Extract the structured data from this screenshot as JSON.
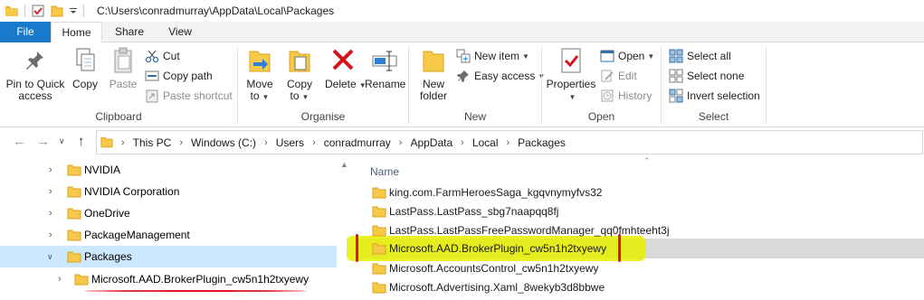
{
  "window": {
    "title": "C:\\Users\\conradmurray\\AppData\\Local\\Packages"
  },
  "ribbon_tabs": [
    {
      "label": "File"
    },
    {
      "label": "Home",
      "active": true
    },
    {
      "label": "Share"
    },
    {
      "label": "View"
    }
  ],
  "ribbon": {
    "clipboard": {
      "label": "Clipboard",
      "pin": "Pin to Quick access",
      "copy": "Copy",
      "paste": "Paste",
      "cut": "Cut",
      "copy_path": "Copy path",
      "paste_shortcut": "Paste shortcut"
    },
    "organise": {
      "label": "Organise",
      "move_to": "Move to",
      "copy_to": "Copy to",
      "delete": "Delete",
      "rename": "Rename"
    },
    "new": {
      "label": "New",
      "new_folder": "New folder",
      "new_item": "New item",
      "easy_access": "Easy access"
    },
    "open": {
      "label": "Open",
      "properties": "Properties",
      "open": "Open",
      "edit": "Edit",
      "history": "History"
    },
    "select": {
      "label": "Select",
      "select_all": "Select all",
      "select_none": "Select none",
      "invert_selection": "Invert selection"
    }
  },
  "address": {
    "breadcrumbs": [
      "This PC",
      "Windows (C:)",
      "Users",
      "conradmurray",
      "AppData",
      "Local",
      "Packages"
    ]
  },
  "nav_pane": {
    "items": [
      {
        "label": "NVIDIA"
      },
      {
        "label": "NVIDIA Corporation"
      },
      {
        "label": "OneDrive"
      },
      {
        "label": "PackageManagement"
      },
      {
        "label": "Packages",
        "selected": true
      },
      {
        "label": "Microsoft.AAD.BrokerPlugin_cw5n1h2txyewy"
      }
    ]
  },
  "file_list": {
    "column_name": "Name",
    "rows": [
      {
        "name": "king.com.FarmHeroesSaga_kgqvnymyfvs32"
      },
      {
        "name": "LastPass.LastPass_sbg7naapqq8fj"
      },
      {
        "name": "LastPass.LastPassFreePasswordManager_qq0fmhteeht3j"
      },
      {
        "name": "Microsoft.AAD.BrokerPlugin_cw5n1h2txyewy",
        "selected": true
      },
      {
        "name": "Microsoft.AccountsControl_cw5n1h2txyewy"
      },
      {
        "name": "Microsoft.Advertising.Xaml_8wekyb3d8bbwe"
      }
    ]
  },
  "colors": {
    "file_tab": "#1979ca",
    "folder": "#e8b52a",
    "selection": "#cce8ff",
    "highlight": "#e6f000",
    "annotation": "#e0141e"
  }
}
